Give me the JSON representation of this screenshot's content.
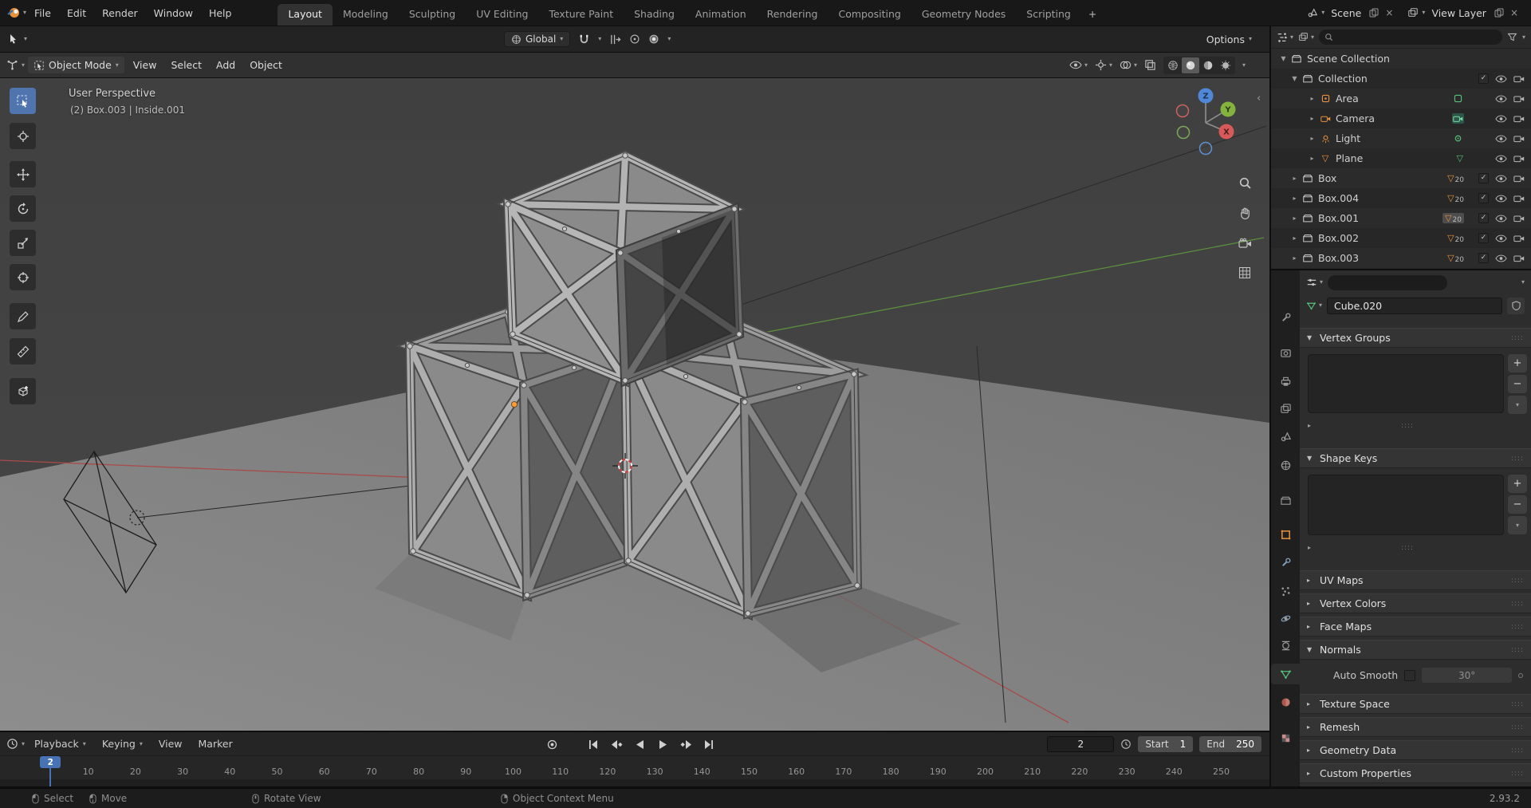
{
  "icons": {
    "dropdown": "▾",
    "collapsed": "▸",
    "expanded": "▼",
    "check": "✓",
    "close": "×",
    "plus": "+",
    "minus": "−",
    "drag": "::::",
    "back": "‹"
  },
  "colors": {
    "accent_blue": "#4772b3",
    "object_orange": "#e8913c",
    "data_green": "#56c179",
    "axis_x_red": "#d45f5f",
    "axis_y_green": "#83b23e",
    "axis_z_blue": "#5087d8"
  },
  "topbar": {
    "menus": [
      "File",
      "Edit",
      "Render",
      "Window",
      "Help"
    ],
    "workspaces": [
      "Layout",
      "Modeling",
      "Sculpting",
      "UV Editing",
      "Texture Paint",
      "Shading",
      "Animation",
      "Rendering",
      "Compositing",
      "Geometry Nodes",
      "Scripting"
    ],
    "add_tab": "+",
    "scene_label": "Scene",
    "view_layer_label": "View Layer"
  },
  "tool_settings": {
    "orientation": "Global",
    "options_label": "Options"
  },
  "viewport": {
    "header": {
      "mode": "Object Mode",
      "menus": [
        "View",
        "Select",
        "Add",
        "Object"
      ]
    },
    "overlay": {
      "view_label": "User Perspective",
      "active_object": "(2) Box.003 | Inside.001"
    },
    "gizmo": {
      "x": "X",
      "y": "Y",
      "z": "Z"
    }
  },
  "outliner": {
    "rows": [
      {
        "label": "Scene Collection"
      },
      {
        "label": "Collection"
      },
      {
        "label": "Area"
      },
      {
        "label": "Camera"
      },
      {
        "label": "Light"
      },
      {
        "label": "Plane"
      },
      {
        "label": "Box",
        "count": "20"
      },
      {
        "label": "Box.004",
        "count": "20"
      },
      {
        "label": "Box.001",
        "count": "20"
      },
      {
        "label": "Box.002",
        "count": "20"
      },
      {
        "label": "Box.003",
        "count": "20"
      }
    ]
  },
  "properties": {
    "datablock_name": "Cube.020",
    "panels": [
      {
        "label": "Vertex Groups"
      },
      {
        "label": "Shape Keys"
      },
      {
        "label": "UV Maps"
      },
      {
        "label": "Vertex Colors"
      },
      {
        "label": "Face Maps"
      },
      {
        "label": "Normals"
      },
      {
        "label": "Texture Space"
      },
      {
        "label": "Remesh"
      },
      {
        "label": "Geometry Data"
      },
      {
        "label": "Custom Properties"
      }
    ],
    "normals": {
      "auto_smooth_label": "Auto Smooth",
      "auto_smooth_angle": "30°"
    }
  },
  "timeline": {
    "menus": [
      "Playback",
      "Keying",
      "View",
      "Marker"
    ],
    "current_frame": "2",
    "start_label": "Start",
    "start_value": "1",
    "end_label": "End",
    "end_value": "250",
    "ticks": [
      10,
      20,
      30,
      40,
      50,
      60,
      70,
      80,
      90,
      100,
      110,
      120,
      130,
      140,
      150,
      160,
      170,
      180,
      190,
      200,
      210,
      220,
      230,
      240,
      250
    ]
  },
  "statusbar": {
    "items": [
      {
        "label": "Select"
      },
      {
        "label": "Move"
      },
      {
        "label": "Rotate View"
      },
      {
        "label": "Object Context Menu"
      }
    ],
    "version": "2.93.2"
  }
}
